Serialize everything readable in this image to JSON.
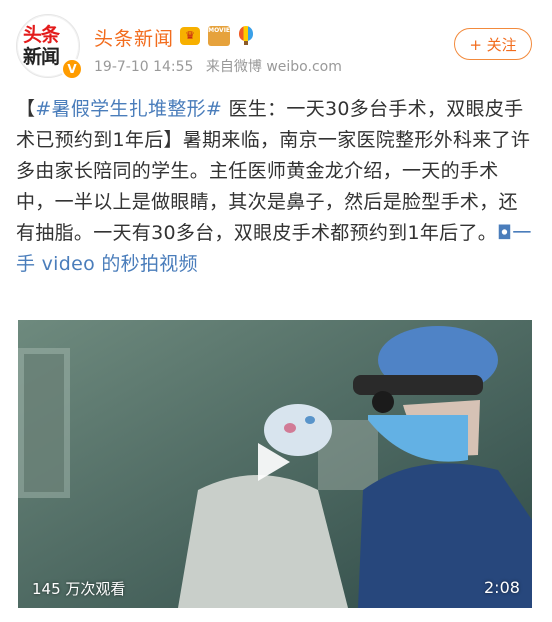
{
  "post": {
    "user_name": "头条新闻",
    "avatar_line1": "头条",
    "avatar_line2": "新闻",
    "verified_mark": "V",
    "date": "19-7-10 14:55",
    "source": "来自微博 weibo.com",
    "follow_label": "+ 关注",
    "text": {
      "bracket_open": "【",
      "hashtag": "#暑假学生扎堆整形#",
      "body": " 医生：一天30多台手术，双眼皮手术已预约到1年后】暑期来临，南京一家医院整形外科来了许多由家长陪同的学生。主任医师黄金龙介绍，一天的手术中，一半以上是做眼睛，其次是鼻子，然后是脸型手术，还有抽脂。一天有30多台，双眼皮手术都预约到1年后了。",
      "video_link": "一手 video 的秒拍视频"
    }
  },
  "badges": {
    "crown_icon": "crown-badge-icon",
    "movie_icon": "movie-badge-icon",
    "movie_label": "MOVIE",
    "balloon_icon": "hot-air-balloon-icon"
  },
  "video": {
    "views": "145 万次观看",
    "duration": "2:08",
    "play_icon": "play-icon"
  },
  "colors": {
    "name_orange": "#f26c1d",
    "link_blue": "#4a7dbb",
    "meta_gray": "#999999",
    "text": "#333333"
  }
}
